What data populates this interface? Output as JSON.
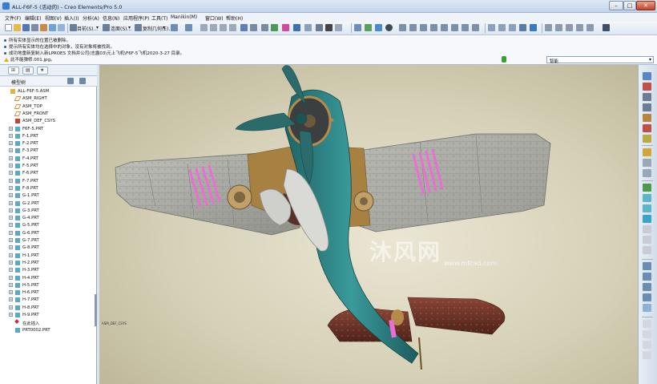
{
  "window": {
    "title": "ALL-F6F-5 (活动的) - Creo Elements/Pro 5.0",
    "controls": {
      "minimize": "–",
      "maximize": "□",
      "close": "✕"
    }
  },
  "menu": [
    {
      "label": "文件(F)"
    },
    {
      "label": "编辑(E)"
    },
    {
      "label": "视图(V)"
    },
    {
      "label": "插入(I)"
    },
    {
      "label": "分析(A)"
    },
    {
      "label": "信息(N)"
    },
    {
      "label": "应用程序(P)"
    },
    {
      "label": "工具(T)"
    },
    {
      "label": "Manikin(M)"
    },
    {
      "label": "窗口(W)"
    },
    {
      "label": "帮助(H)"
    }
  ],
  "toolbar": {
    "regenerate_label": "目前(S)...",
    "surfaces_label": "连面(S)...",
    "copy_geom_label": "复制几何(E)...",
    "dropdown_arrow": "▾"
  },
  "messages": [
    {
      "text": "所有实体显示的位置已被删除。",
      "type": "info"
    },
    {
      "text": "提示所有实体均在选择中的对象，没有对象将被找到。",
      "type": "info"
    },
    {
      "text": "成功地重新复制入新LPROES 文档并公司(志露03\\元上飞机\\F6F-5飞机2020-3-27 目录。",
      "type": "info"
    },
    {
      "text": "此不能弹修.001.jpg。",
      "type": "warning"
    }
  ],
  "filter": {
    "value": "智能",
    "arrow": "▾"
  },
  "left_panel": {
    "tabs": [
      {
        "icon": "model-tree-icon",
        "glyph": "⊞"
      },
      {
        "icon": "folder-browser-icon",
        "glyph": "▤"
      },
      {
        "icon": "favorites-icon",
        "glyph": "★"
      }
    ],
    "header_label": "模型树",
    "tree": [
      {
        "label": "ALL-F6F-5.ASM",
        "kind": "asm",
        "indent": 0,
        "expander": ""
      },
      {
        "label": "ASM_RIGHT",
        "kind": "datum",
        "indent": 1,
        "expander": ""
      },
      {
        "label": "ASM_TOP",
        "kind": "datum",
        "indent": 1,
        "expander": ""
      },
      {
        "label": "ASM_FRONT",
        "kind": "datum",
        "indent": 1,
        "expander": ""
      },
      {
        "label": "ASM_DEF_CSYS",
        "kind": "csys",
        "indent": 1,
        "expander": ""
      },
      {
        "label": "F6F-5.PRT",
        "kind": "part",
        "indent": 1,
        "expander": "+"
      },
      {
        "label": "F-1.PRT",
        "kind": "part",
        "indent": 1,
        "expander": "+"
      },
      {
        "label": "F-2.PRT",
        "kind": "part",
        "indent": 1,
        "expander": "+"
      },
      {
        "label": "F-3.PRT",
        "kind": "part",
        "indent": 1,
        "expander": "+"
      },
      {
        "label": "F-4.PRT",
        "kind": "part",
        "indent": 1,
        "expander": "+"
      },
      {
        "label": "F-5.PRT",
        "kind": "part",
        "indent": 1,
        "expander": "+"
      },
      {
        "label": "F-6.PRT",
        "kind": "part",
        "indent": 1,
        "expander": "+"
      },
      {
        "label": "F-7.PRT",
        "kind": "part",
        "indent": 1,
        "expander": "+"
      },
      {
        "label": "F-8.PRT",
        "kind": "part",
        "indent": 1,
        "expander": "+"
      },
      {
        "label": "G-1.PRT",
        "kind": "part",
        "indent": 1,
        "expander": "+"
      },
      {
        "label": "G-2.PRT",
        "kind": "part",
        "indent": 1,
        "expander": "+"
      },
      {
        "label": "G-3.PRT",
        "kind": "part",
        "indent": 1,
        "expander": "+"
      },
      {
        "label": "G-4.PRT",
        "kind": "part",
        "indent": 1,
        "expander": "+"
      },
      {
        "label": "G-5.PRT",
        "kind": "part",
        "indent": 1,
        "expander": "+"
      },
      {
        "label": "G-6.PRT",
        "kind": "part",
        "indent": 1,
        "expander": "+"
      },
      {
        "label": "G-7.PRT",
        "kind": "part",
        "indent": 1,
        "expander": "+"
      },
      {
        "label": "G-8.PRT",
        "kind": "part",
        "indent": 1,
        "expander": "+"
      },
      {
        "label": "H-1.PRT",
        "kind": "part",
        "indent": 1,
        "expander": "+"
      },
      {
        "label": "H-2.PRT",
        "kind": "part",
        "indent": 1,
        "expander": "+"
      },
      {
        "label": "H-3.PRT",
        "kind": "part",
        "indent": 1,
        "expander": "+"
      },
      {
        "label": "H-4.PRT",
        "kind": "part",
        "indent": 1,
        "expander": "+"
      },
      {
        "label": "H-5.PRT",
        "kind": "part",
        "indent": 1,
        "expander": "+"
      },
      {
        "label": "H-6.PRT",
        "kind": "part",
        "indent": 1,
        "expander": "+"
      },
      {
        "label": "H-7.PRT",
        "kind": "part",
        "indent": 1,
        "expander": "+"
      },
      {
        "label": "H-8.PRT",
        "kind": "part",
        "indent": 1,
        "expander": "+"
      },
      {
        "label": "H-9.PRT",
        "kind": "part",
        "indent": 1,
        "expander": "+"
      },
      {
        "label": "在此插入",
        "kind": "insert",
        "indent": 1,
        "expander": ""
      },
      {
        "label": "PRT0002.PRT",
        "kind": "part",
        "indent": 1,
        "expander": ""
      }
    ]
  },
  "graphics": {
    "watermark": "沐风网",
    "watermark_url": "www.mfcad.com",
    "csys_label": "ASM_DEF_CSYS"
  },
  "colors": {
    "fuselage": "#2e7f80",
    "wing_grey": "#a9aaa4",
    "tail_brown": "#6e3528",
    "accent_pink": "#ea6fd3",
    "bronze": "#b58a4a",
    "prop_teal": "#2c6b6c"
  }
}
